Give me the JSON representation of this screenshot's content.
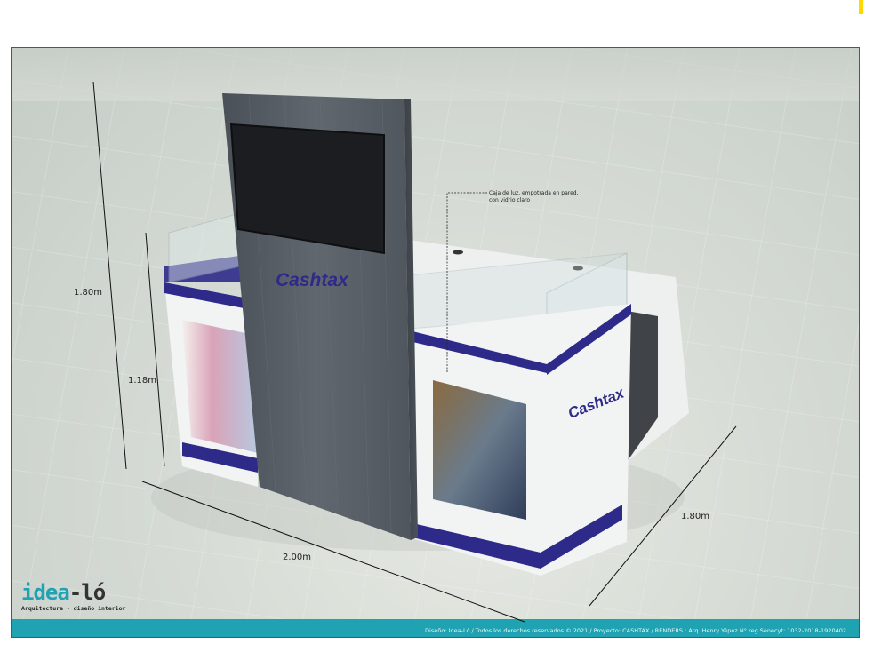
{
  "dimensions": {
    "total_height": "1.80m",
    "counter_height": "1.18m",
    "width": "2.00m",
    "depth": "1.80m"
  },
  "annotation": "Caja de luz, empotrada en pared, con vidrio claro",
  "brand_text": "Cashtax",
  "footer": "Diseño: Idea-Ló / Todos los derechos reservados © 2021 / Proyecto: CASHTAX / RENDERS : Arq. Henry Yépez  N° reg Senecyt: 1032-2018-1920402",
  "logo": {
    "part_a": "idea",
    "part_b": "-ló",
    "subtitle": "Arquitectura - diseño interior"
  },
  "colors": {
    "accent_teal": "#1fa3b3",
    "stripe_blue": "#2e2a8a",
    "brand_orange": "#e8582a",
    "wood_gray": "#555b62"
  }
}
